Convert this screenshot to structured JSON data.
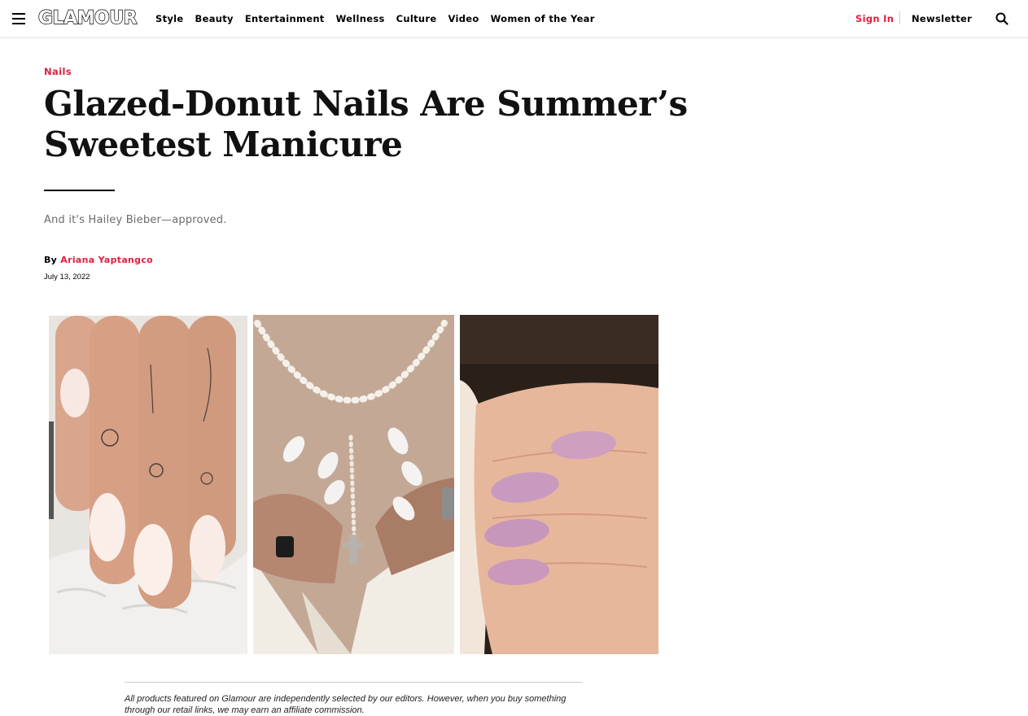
{
  "header": {
    "logo": "GLAMOUR",
    "nav": [
      "Style",
      "Beauty",
      "Entertainment",
      "Wellness",
      "Culture",
      "Video",
      "Women of the Year"
    ],
    "sign_in": "Sign In",
    "newsletter": "Newsletter",
    "icons": {
      "menu": "hamburger-menu-icon",
      "search": "search-icon"
    }
  },
  "article": {
    "rubric": "Nails",
    "headline": "Glazed-Donut Nails Are Summer’s Sweetest Manicure",
    "dek": "And it's Hailey Bieber—approved.",
    "byline_prefix": "By",
    "author": "Ariana Yaptangco",
    "date": "July 13, 2022"
  },
  "disclaimer": "All products featured on Glamour are independently selected by our editors. However, when you buy something through our retail links, we may earn an affiliate commission.",
  "colors": {
    "accent": "#e0203f",
    "text": "#000000",
    "dek": "#6b6b6b",
    "divider": "#e2e2e2"
  }
}
